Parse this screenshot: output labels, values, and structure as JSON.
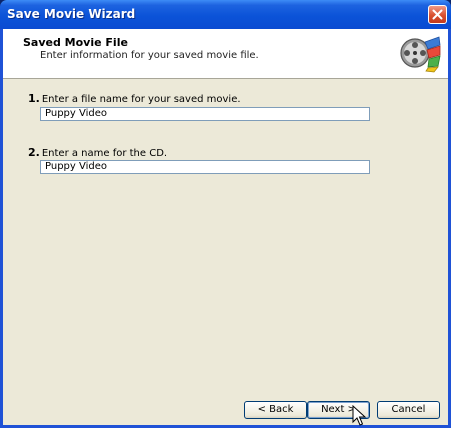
{
  "window": {
    "title": "Save Movie Wizard"
  },
  "header": {
    "title": "Saved Movie File",
    "subtitle": "Enter information for your saved movie file.",
    "icon": "film-reel-icon"
  },
  "steps": [
    {
      "number": "1.",
      "label": "Enter a file name for your saved movie.",
      "value": "Puppy Video"
    },
    {
      "number": "2.",
      "label": "Enter a name for the CD.",
      "value": "Puppy Video"
    }
  ],
  "buttons": {
    "back": "< Back",
    "next": "Next >",
    "cancel": "Cancel"
  },
  "colors": {
    "title_bar": "#0b53d8",
    "client_bg": "#ece9d8",
    "close_button": "#d9502f"
  }
}
